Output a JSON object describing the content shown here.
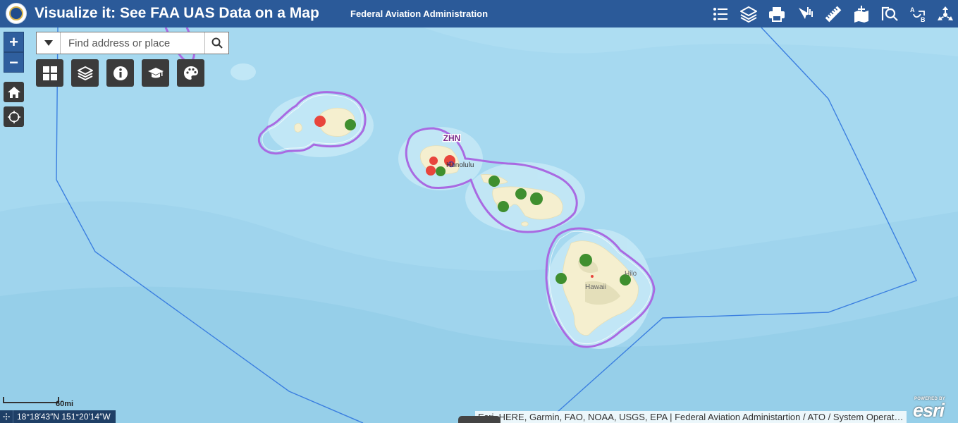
{
  "header": {
    "title": "Visualize it: See FAA UAS Data on a Map",
    "subtitle": "Federal Aviation Administration",
    "buttons": [
      "legend-icon",
      "layers-icon",
      "print-icon",
      "select-icon",
      "measure-icon",
      "add-data-icon",
      "query-icon",
      "directions-icon",
      "share-icon"
    ]
  },
  "search": {
    "placeholder": "Find address or place",
    "value": ""
  },
  "map_controls": {
    "zoom_in": "+",
    "zoom_out": "−"
  },
  "map_labels": {
    "artcc": "ZHN",
    "honolulu": "Honolulu",
    "hilo": "Hilo",
    "hawaii": "Hawaii"
  },
  "scale": {
    "label": "60mi"
  },
  "coordinates": {
    "text": "18°18′43″N 151°20′14″W"
  },
  "attribution": {
    "text": "Esri, HERE, Garmin, FAO, NOAA, USGS, EPA | Federal Aviation Administartion / ATO / System Operat…"
  },
  "branding": {
    "powered_by": "POWERED BY",
    "logo": "esri"
  },
  "colors": {
    "header": "#2b5a99",
    "ocean": "#a6d9f0",
    "land": "#f5efcf",
    "boundary": "#a96ae2",
    "red_marker": "#e8453c",
    "green_marker": "#3f8f2f",
    "artcc_line": "#3b7fe0"
  }
}
